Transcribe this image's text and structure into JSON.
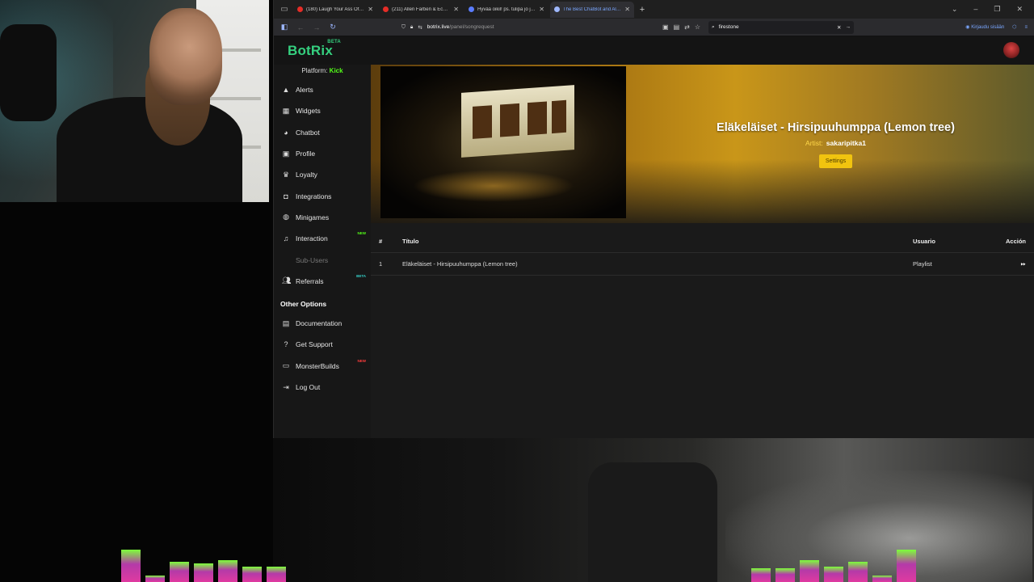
{
  "browser": {
    "tabs": [
      {
        "title": "(180) Laugh Your Ass Off! Epic",
        "favicon_color": "#e52d27",
        "active": false
      },
      {
        "title": "(211) Allen Farben & Ecole Gan",
        "favicon_color": "#e52d27",
        "active": false
      },
      {
        "title": "Hyvää oikil! ps. tulipa jo joulu!",
        "favicon_color": "#5a7cff",
        "active": false
      },
      {
        "title": "The Best ChatBot and Alerts",
        "favicon_color": "#9fb8ff",
        "active": true
      }
    ],
    "address": {
      "host": "botrix.live",
      "path": "/panel/songrequest"
    },
    "search_value": "firestone",
    "account_label": "Kirjaudu sisään"
  },
  "app": {
    "logo": "BotRix",
    "logo_badge": "BETA",
    "platform_label": "Platform:",
    "platform_value": "Kick",
    "accent": "#35d07f"
  },
  "sidebar": {
    "items": [
      {
        "label": "Alerts",
        "icon": "warning-icon"
      },
      {
        "label": "Widgets",
        "icon": "grid-icon"
      },
      {
        "label": "Chatbot",
        "icon": "robot-icon"
      },
      {
        "label": "Profile",
        "icon": "id-card-icon"
      },
      {
        "label": "Loyalty",
        "icon": "trophy-icon"
      },
      {
        "label": "Integrations",
        "icon": "plug-icon"
      },
      {
        "label": "Minigames",
        "icon": "gamepad-icon"
      },
      {
        "label": "Interaction",
        "icon": "music-icon",
        "badge": "NEW"
      },
      {
        "label": "Sub-Users",
        "icon": "",
        "disabled": true
      },
      {
        "label": "Referrals",
        "icon": "users-icon",
        "badge": "BETA"
      }
    ],
    "other_title": "Other Options",
    "other_items": [
      {
        "label": "Documentation",
        "icon": "book-icon"
      },
      {
        "label": "Get Support",
        "icon": "help-icon"
      },
      {
        "label": "MonsterBuilds",
        "icon": "laptop-icon",
        "badge": "NEW"
      },
      {
        "label": "Log Out",
        "icon": "logout-icon"
      }
    ]
  },
  "now_playing": {
    "title": "Eläkeläiset - Hirsipuuhumppa (Lemon tree)",
    "artist_label": "Artist:",
    "artist": "sakaripitka1",
    "settings_label": "Settings"
  },
  "queue": {
    "headers": {
      "num": "#",
      "title": "Título",
      "user": "Usuario",
      "action": "Acción"
    },
    "rows": [
      {
        "num": "1",
        "title": "Eläkeläiset - Hirsipuuhumppa (Lemon tree)",
        "user": "Playlist",
        "action_icon": "fast-forward-icon"
      }
    ]
  },
  "audio_meter": {
    "left_levels": [
      0.95,
      0.2,
      0.6,
      0.55,
      0.65,
      0.45,
      0.45
    ],
    "right_levels": [
      0.4,
      0.4,
      0.65,
      0.45,
      0.6,
      0.2,
      0.95
    ]
  }
}
